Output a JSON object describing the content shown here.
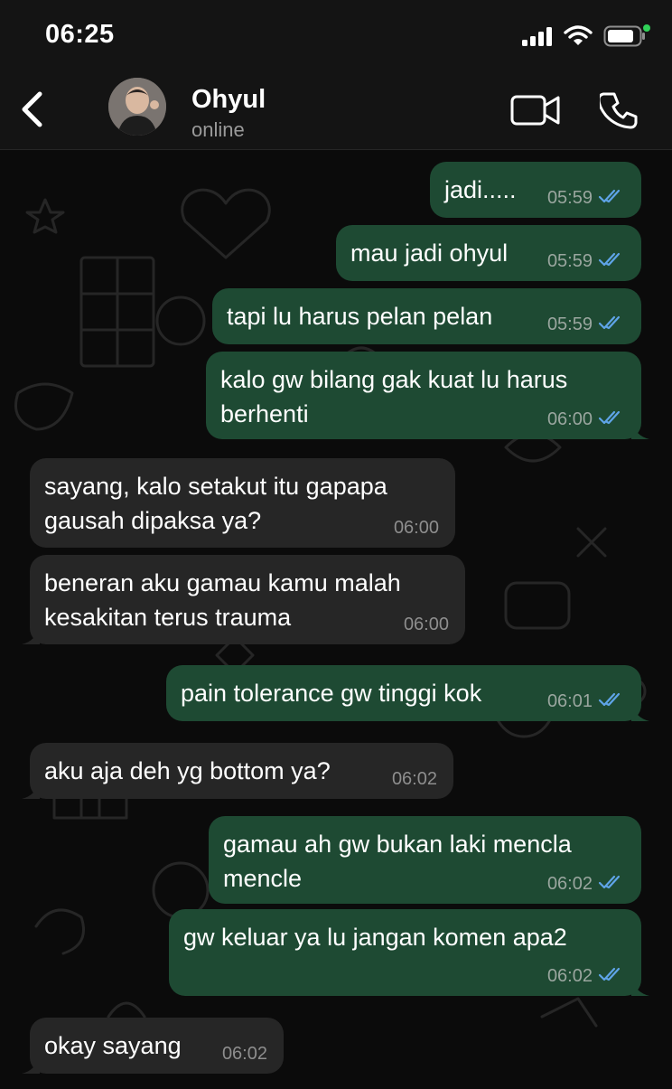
{
  "status_bar": {
    "time": "06:25"
  },
  "header": {
    "contact_name": "Ohyul",
    "contact_status": "online",
    "icons": {
      "back": "chevron-left-icon",
      "video": "video-camera-icon",
      "call": "phone-icon"
    }
  },
  "colors": {
    "outgoing_bubble": "#1e4a33",
    "incoming_bubble": "#262626",
    "read_receipt": "#5fa4e8",
    "battery_indicator": "#30d158"
  },
  "messages": [
    {
      "direction": "out",
      "text": "jadi.....",
      "time": "05:59",
      "read": true
    },
    {
      "direction": "out",
      "text": "mau jadi ohyul",
      "time": "05:59",
      "read": true
    },
    {
      "direction": "out",
      "text": "tapi lu harus pelan pelan",
      "time": "05:59",
      "read": true
    },
    {
      "direction": "out",
      "text": "kalo gw bilang gak kuat lu harus berhenti",
      "time": "06:00",
      "read": true
    },
    {
      "direction": "in",
      "text": "sayang, kalo setakut itu gapapa gausah dipaksa ya?",
      "time": "06:00"
    },
    {
      "direction": "in",
      "text": "beneran aku gamau kamu malah kesakitan terus trauma",
      "time": "06:00"
    },
    {
      "direction": "out",
      "text": "pain tolerance gw tinggi kok",
      "time": "06:01",
      "read": true
    },
    {
      "direction": "in",
      "text": "aku aja deh yg bottom ya?",
      "time": "06:02"
    },
    {
      "direction": "out",
      "text": "gamau ah gw bukan laki mencla mencle",
      "time": "06:02",
      "read": true
    },
    {
      "direction": "out",
      "text": "gw keluar ya lu jangan komen apa2",
      "time": "06:02",
      "read": true
    },
    {
      "direction": "in",
      "text": "okay sayang",
      "time": "06:02"
    }
  ]
}
